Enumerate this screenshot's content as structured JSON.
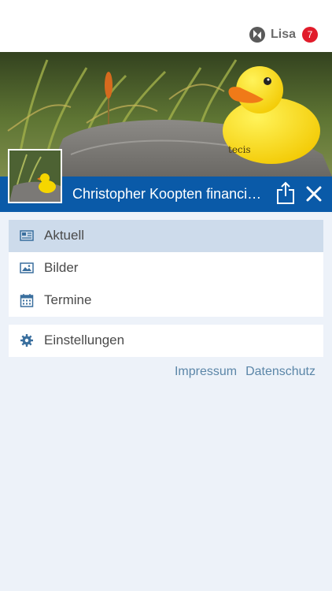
{
  "header": {
    "user_name": "Lisa",
    "notification_count": "7",
    "logo_icon": "app-logo-icon"
  },
  "hero": {
    "image_subject": "rubber duck on rock",
    "duck_imprint": "tecis"
  },
  "titlebar": {
    "title": "Christopher Koopten financial...",
    "share_icon": "share-icon",
    "close_icon": "close-icon"
  },
  "menu": {
    "items": [
      {
        "label": "Aktuell",
        "icon": "newspaper-icon",
        "active": true
      },
      {
        "label": "Bilder",
        "icon": "image-icon",
        "active": false
      },
      {
        "label": "Termine",
        "icon": "calendar-icon",
        "active": false
      }
    ],
    "settings": {
      "label": "Einstellungen",
      "icon": "gear-icon"
    }
  },
  "footer": {
    "impressum": "Impressum",
    "datenschutz": "Datenschutz"
  },
  "colors": {
    "accent": "#0a5aa8",
    "badge": "#e11c2b",
    "active_item": "#cddbeb",
    "background": "#edf2f9",
    "link": "#5b86a8"
  }
}
